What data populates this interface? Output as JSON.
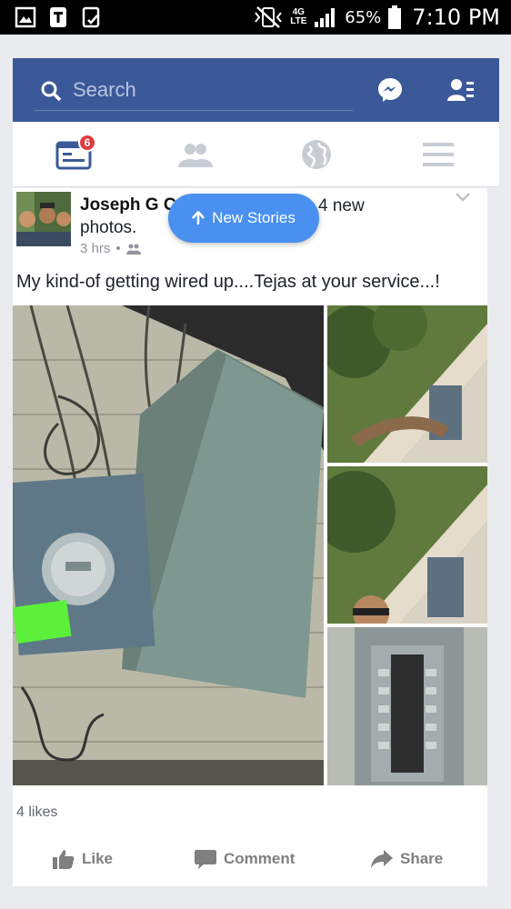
{
  "status_bar": {
    "network": "4G LTE",
    "battery_pct": "65%",
    "time": "7:10 PM"
  },
  "header": {
    "search_placeholder": "Search"
  },
  "nav": {
    "notification_count": "6"
  },
  "post": {
    "author": "Joseph G C",
    "headline_rest": "4 new",
    "headline_line2": "photos.",
    "time": "3 hrs",
    "caption": "My kind-of getting wired up....Tejas at your service...!",
    "likes": "4 likes",
    "actions": {
      "like": "Like",
      "comment": "Comment",
      "share": "Share"
    }
  },
  "new_stories": {
    "label": "New Stories"
  },
  "colors": {
    "brand": "#3b5998",
    "pill": "#4a90f0",
    "badge": "#e03a3e"
  }
}
